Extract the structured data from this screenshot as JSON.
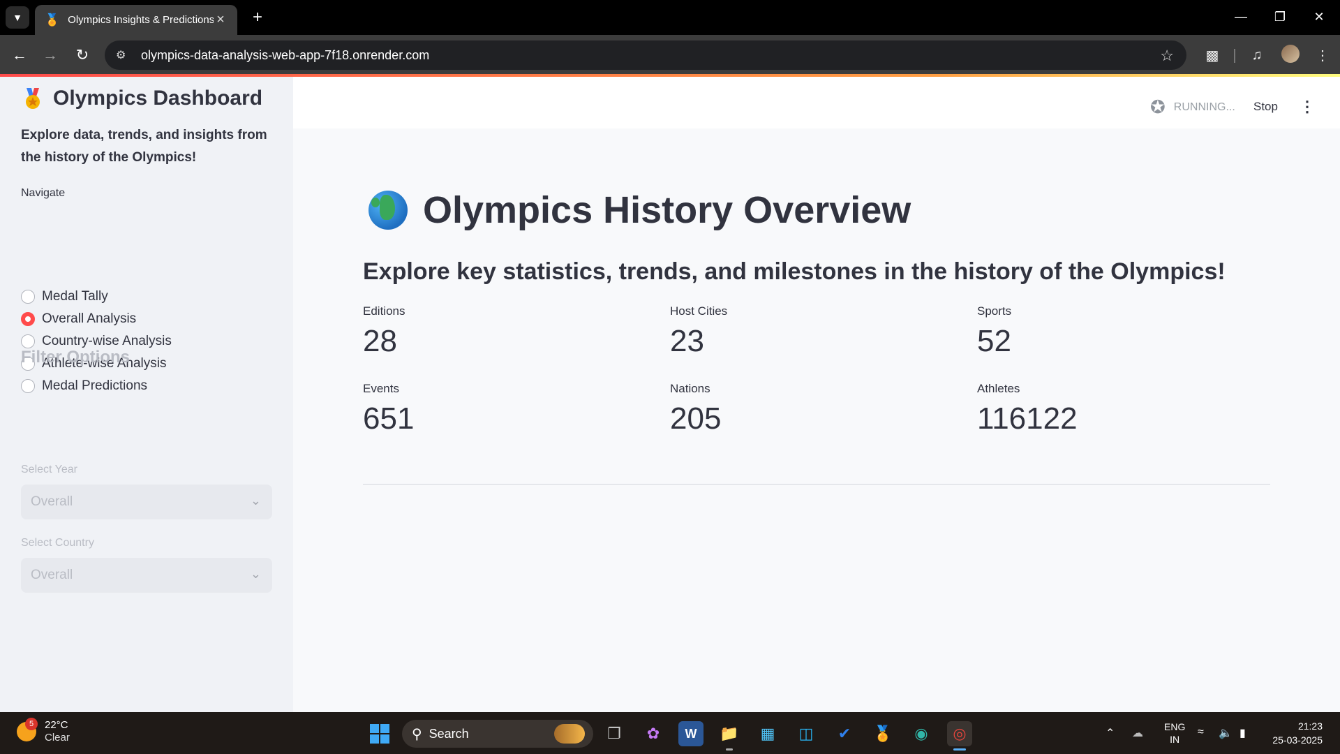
{
  "browser": {
    "tab_title": "Olympics Insights & Predictions",
    "url": "olympics-data-analysis-web-app-7f18.onrender.com"
  },
  "sidebar": {
    "title": "Olympics Dashboard",
    "description": "Explore data, trends, and insights from the history of the Olympics!",
    "nav_label": "Navigate",
    "nav_items": [
      {
        "label": "Medal Tally",
        "selected": false
      },
      {
        "label": "Overall Analysis",
        "selected": true
      },
      {
        "label": "Country-wise Analysis",
        "selected": false
      },
      {
        "label": "Athlete-wise Analysis",
        "selected": false
      },
      {
        "label": "Medal Predictions",
        "selected": false
      }
    ],
    "filter_title": "Filter Options",
    "year_label": "Select Year",
    "year_value": "Overall",
    "country_label": "Select Country",
    "country_value": "Overall"
  },
  "status": {
    "running_text": "RUNNING...",
    "stop_label": "Stop"
  },
  "main": {
    "title": "Olympics History Overview",
    "subtitle": "Explore key statistics, trends, and milestones in the history of the Olympics!",
    "metrics": [
      {
        "label": "Editions",
        "value": "28"
      },
      {
        "label": "Host Cities",
        "value": "23"
      },
      {
        "label": "Sports",
        "value": "52"
      },
      {
        "label": "Events",
        "value": "651"
      },
      {
        "label": "Nations",
        "value": "205"
      },
      {
        "label": "Athletes",
        "value": "116122"
      }
    ]
  },
  "taskbar": {
    "weather_temp": "22°C",
    "weather_cond": "Clear",
    "weather_badge": "5",
    "search_label": "Search",
    "lang_line1": "ENG",
    "lang_line2": "IN",
    "time": "21:23",
    "date": "25-03-2025"
  },
  "colors": {
    "accent": "#ff4b4b",
    "text": "#31333f",
    "sidebar_bg": "#f0f2f6"
  }
}
